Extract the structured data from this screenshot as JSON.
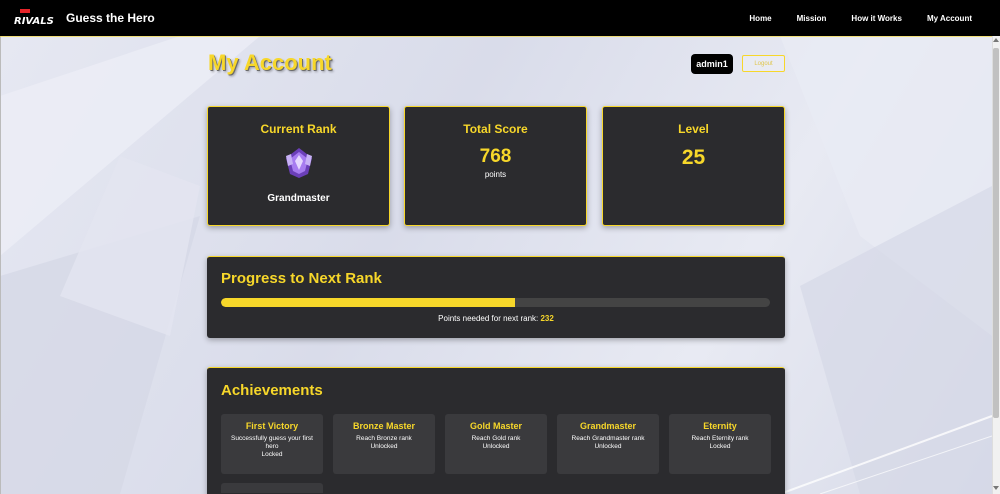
{
  "nav": {
    "brand": "Guess the Hero",
    "logo_text": "RIVALS",
    "links": [
      "Home",
      "Mission",
      "How it Works",
      "My Account"
    ]
  },
  "page": {
    "title": "My Account",
    "username": "admin1",
    "logout_label": "Logout"
  },
  "stats": {
    "rank": {
      "title": "Current Rank",
      "name": "Grandmaster",
      "icon": "grandmaster-rank-icon"
    },
    "score": {
      "title": "Total Score",
      "value": "768",
      "unit": "points"
    },
    "level": {
      "title": "Level",
      "value": "25"
    }
  },
  "progress": {
    "title": "Progress to Next Rank",
    "fill_fraction": 0.536,
    "note_label": "Points needed for next rank:",
    "points_needed": "232"
  },
  "achievements": {
    "title": "Achievements",
    "items": [
      {
        "title": "First Victory",
        "desc": "Successfully guess your first hero",
        "status": "Locked"
      },
      {
        "title": "Bronze Master",
        "desc": "Reach Bronze rank",
        "status": "Unlocked"
      },
      {
        "title": "Gold Master",
        "desc": "Reach Gold rank",
        "status": "Unlocked"
      },
      {
        "title": "Grandmaster",
        "desc": "Reach Grandmaster rank",
        "status": "Unlocked"
      },
      {
        "title": "Eternity",
        "desc": "Reach Eternity rank",
        "status": "Locked"
      }
    ]
  },
  "colors": {
    "accent": "#f7d72a",
    "card": "#2b2b2e",
    "nav": "#000000"
  }
}
